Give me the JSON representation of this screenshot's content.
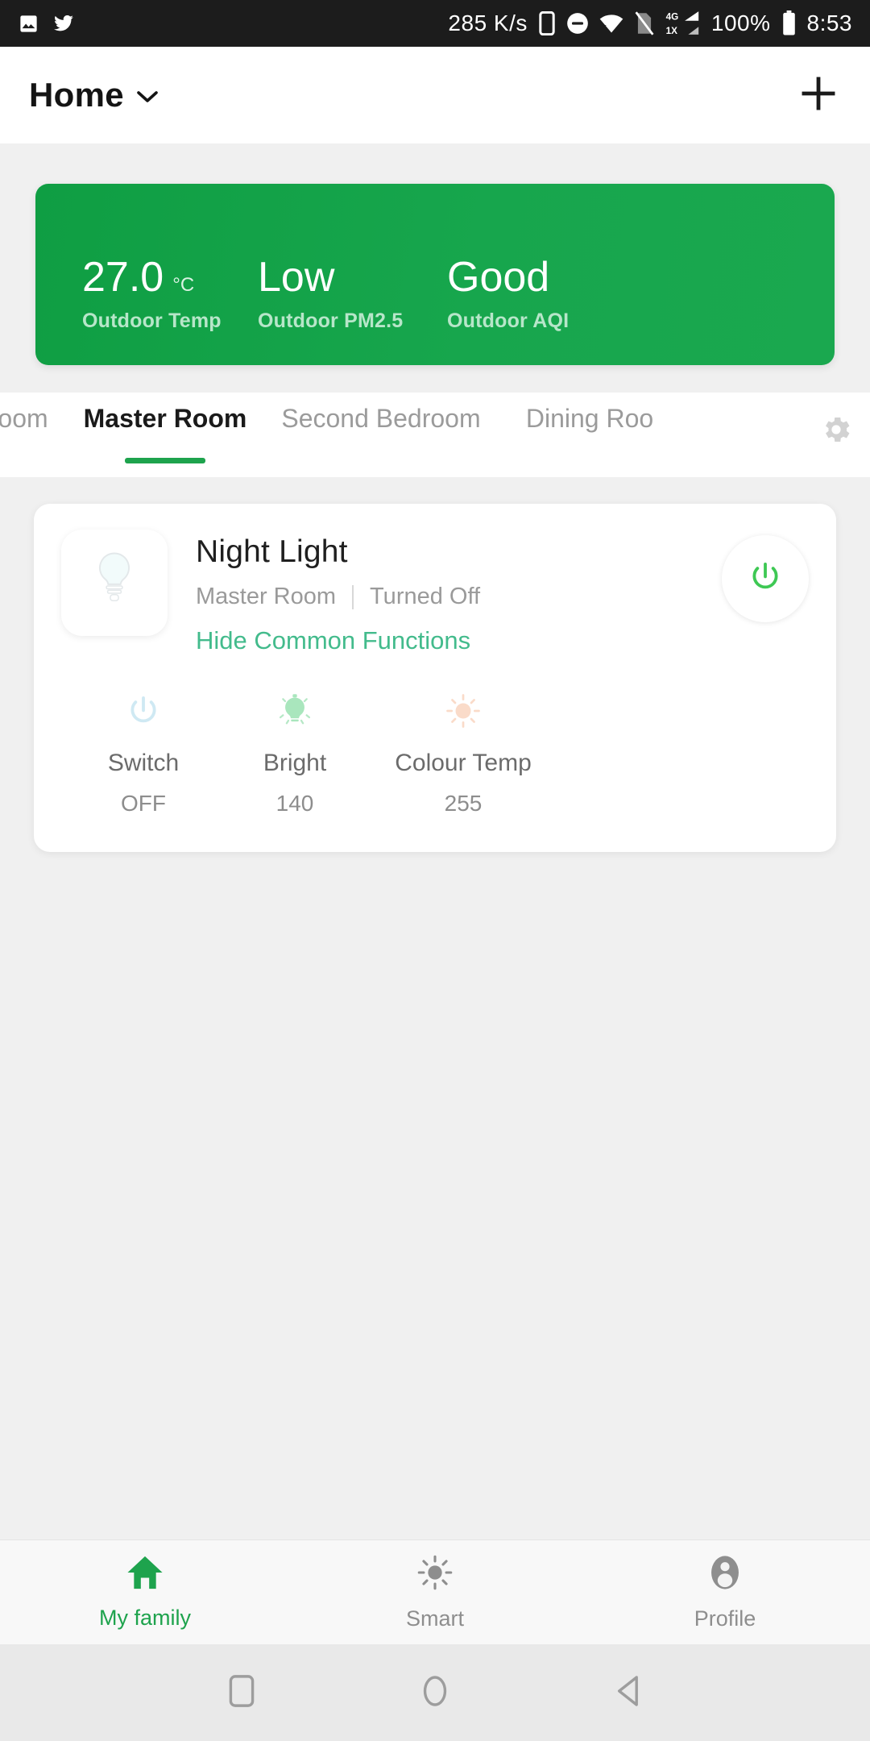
{
  "statusbar": {
    "left_icons": [
      "image-icon",
      "twitter-icon"
    ],
    "network_speed": "285 K/s",
    "right_icons": [
      "vibrate-icon",
      "do-not-disturb-icon",
      "wifi-icon",
      "sim-off-icon",
      "signal-4g-1x-icon"
    ],
    "battery_percent": "100%",
    "battery_icon": "battery-full-icon",
    "clock": "8:53"
  },
  "appbar": {
    "title": "Home",
    "dropdown_icon": "chevron-down-icon",
    "add_icon": "plus-icon"
  },
  "env_card": {
    "accent_color": "#13a44c",
    "metrics": [
      {
        "value": "27.0",
        "unit": "°C",
        "label": "Outdoor Temp"
      },
      {
        "value": "Low",
        "unit": "",
        "label": "Outdoor PM2.5"
      },
      {
        "value": "Good",
        "unit": "",
        "label": "Outdoor AQI"
      }
    ]
  },
  "tabs": {
    "items": [
      {
        "label": "Room",
        "active": false
      },
      {
        "label": "Master Room",
        "active": true
      },
      {
        "label": "Second Bedroom",
        "active": false
      },
      {
        "label": "Dining Roo",
        "active": false
      }
    ],
    "settings_icon": "gear-icon",
    "active_underline_color": "#1ea34d"
  },
  "device": {
    "thumb_icon": "bulb-icon",
    "name": "Night Light",
    "room": "Master Room",
    "status": "Turned Off",
    "toggle_link": "Hide Common Functions",
    "toggle_link_color": "#43bb8c",
    "power_icon": "power-icon",
    "power_icon_color": "#3ec854",
    "functions": [
      {
        "icon": "power-icon",
        "icon_color": "#cfe9f3",
        "name": "Switch",
        "value": "OFF"
      },
      {
        "icon": "brightness-bulb-icon",
        "icon_color": "#a9e6bd",
        "name": "Bright",
        "value": "140"
      },
      {
        "icon": "colour-temp-sun-icon",
        "icon_color": "#fadbc9",
        "name": "Colour Temp",
        "value": "255"
      }
    ]
  },
  "bottomnav": {
    "items": [
      {
        "icon": "home-icon",
        "label": "My family",
        "active": true
      },
      {
        "icon": "smart-sun-icon",
        "label": "Smart",
        "active": false
      },
      {
        "icon": "profile-avatar-icon",
        "label": "Profile",
        "active": false
      }
    ],
    "active_color": "#1ea34d"
  },
  "androidnav": {
    "buttons": [
      "recents-square-icon",
      "home-circle-icon",
      "back-triangle-icon"
    ]
  }
}
